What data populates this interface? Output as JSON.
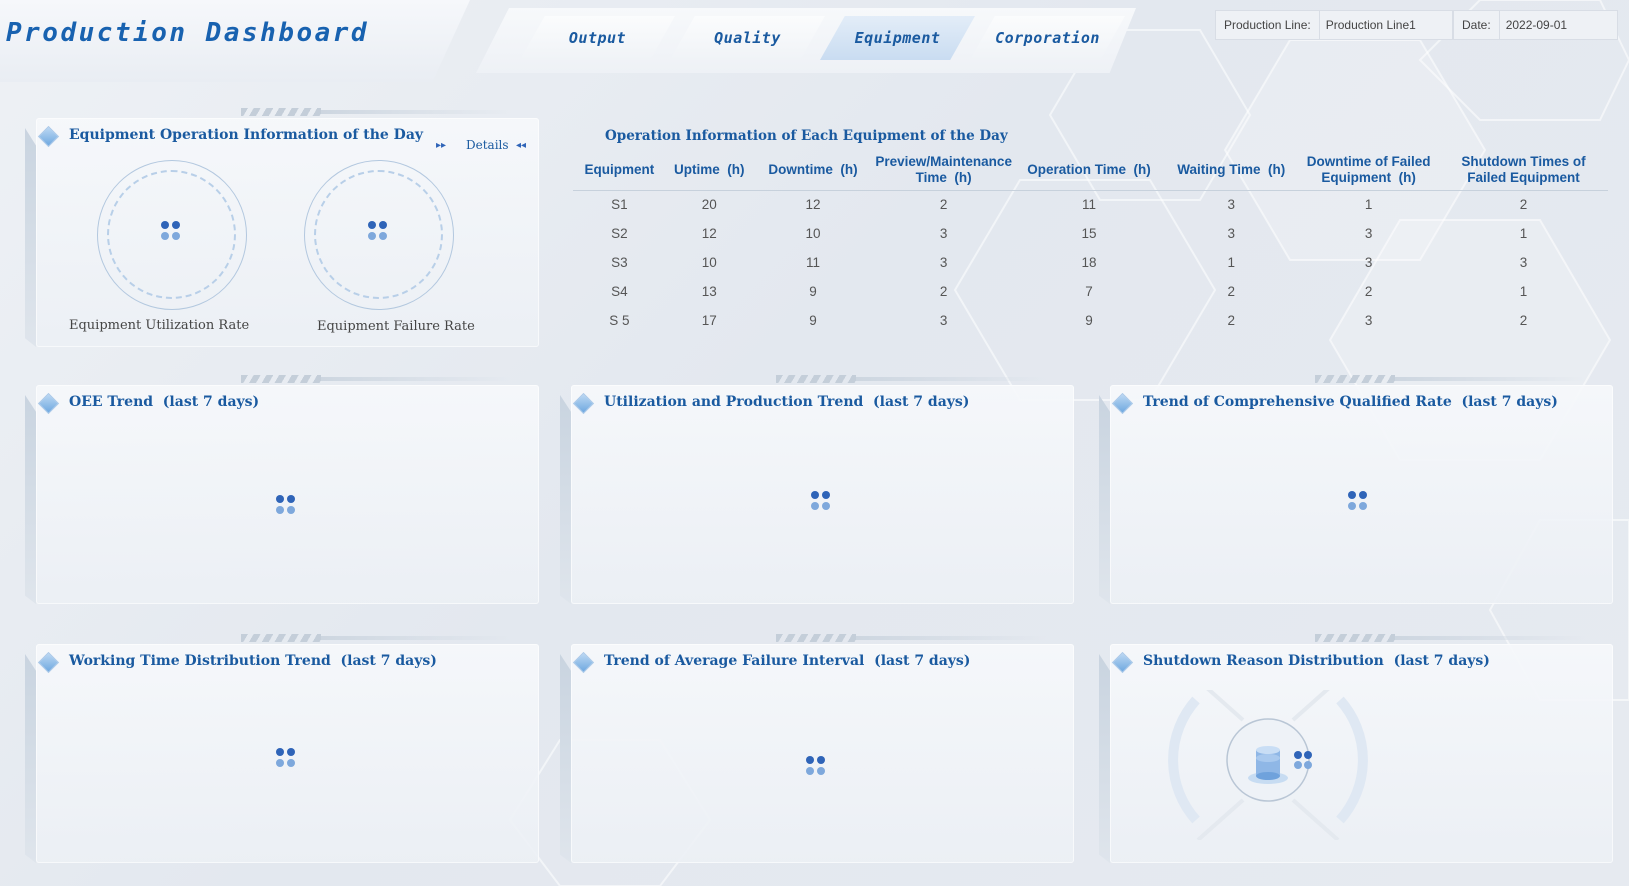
{
  "header": {
    "title": "Production Dashboard",
    "tabs": [
      {
        "label": "Output",
        "active": false
      },
      {
        "label": "Quality",
        "active": false
      },
      {
        "label": "Equipment",
        "active": true
      },
      {
        "label": "Corporation",
        "active": false
      }
    ],
    "filters": {
      "production_line_label": "Production Line:",
      "production_line_value": "Production Line1",
      "date_label": "Date:",
      "date_value": "2022-09-01"
    }
  },
  "operation_panel": {
    "title": "Equipment Operation Information of the Day",
    "details_label": "Details",
    "gauges": [
      {
        "label": "Equipment Utilization Rate"
      },
      {
        "label": "Equipment Failure Rate"
      }
    ]
  },
  "equipment_table": {
    "title": "Operation Information of Each Equipment of the Day",
    "headers": [
      "Equipment",
      "Uptime  (h)",
      "Downtime  (h)",
      "Preview/Maintenance Time  (h)",
      "Operation Time  (h)",
      "Waiting Time  (h)",
      "Downtime of Failed Equipment  (h)",
      "Shutdown Times of Failed Equipment"
    ],
    "rows": [
      [
        "S1",
        "20",
        "12",
        "2",
        "11",
        "3",
        "1",
        "2"
      ],
      [
        "S2",
        "12",
        "10",
        "3",
        "15",
        "3",
        "3",
        "1"
      ],
      [
        "S3",
        "10",
        "11",
        "3",
        "18",
        "1",
        "3",
        "3"
      ],
      [
        "S4",
        "13",
        "9",
        "2",
        "7",
        "2",
        "2",
        "1"
      ],
      [
        "S 5",
        "17",
        "9",
        "3",
        "9",
        "2",
        "3",
        "2"
      ]
    ]
  },
  "panels": {
    "oee": {
      "title": "OEE Trend  (last 7 days)"
    },
    "utilization": {
      "title": "Utilization and Production Trend  (last 7 days)"
    },
    "qualified": {
      "title": "Trend of Comprehensive Qualified Rate  (last 7 days)"
    },
    "working_time": {
      "title": "Working Time Distribution Trend  (last 7 days)"
    },
    "failure_interval": {
      "title": "Trend of Average Failure Interval  (last 7 days)"
    },
    "shutdown": {
      "title": "Shutdown Reason Distribution  (last 7 days)"
    }
  },
  "icons": {
    "loading": "loading-dots-icon",
    "section": "diamond-icon",
    "nav_next": "double-arrow-right-icon",
    "nav_prev": "double-arrow-left-icon",
    "empty_data": "database-icon"
  },
  "colors": {
    "accent": "#1a5aa0",
    "title": "#1862b0",
    "active_tab": "#c9dcf1",
    "loader_dark": "#2f64b8",
    "loader_light": "#7ea8dc"
  }
}
